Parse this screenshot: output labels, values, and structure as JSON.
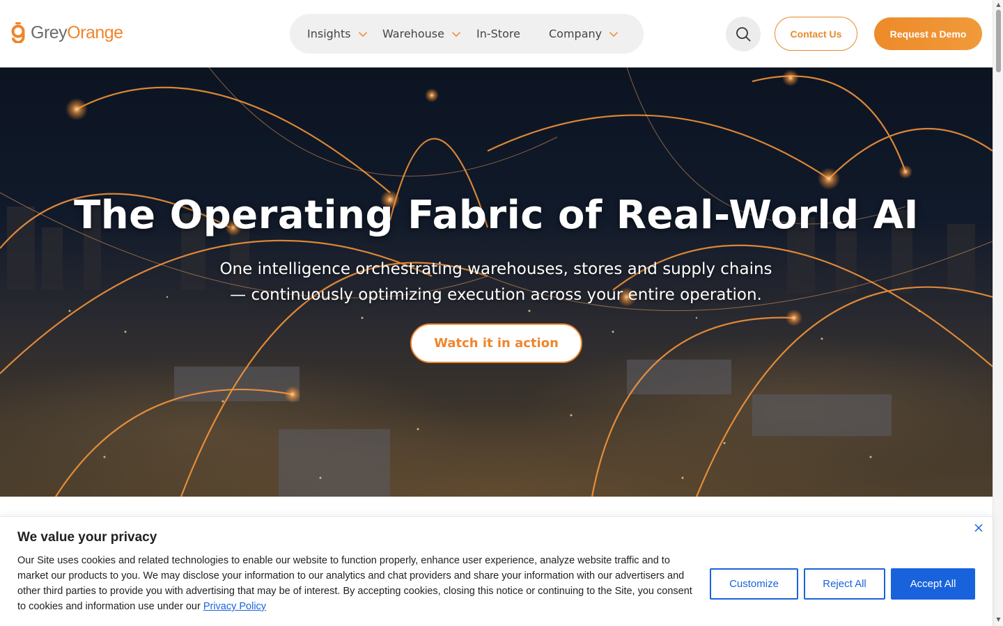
{
  "header": {
    "logo": {
      "grey_text": "Grey",
      "orange_text": "Orange"
    },
    "nav": [
      {
        "label": "Insights",
        "has_dropdown": true
      },
      {
        "label": "Warehouse",
        "has_dropdown": true
      },
      {
        "label": "In-Store",
        "has_dropdown": false
      },
      {
        "label": "Company",
        "has_dropdown": true
      }
    ],
    "search_icon": "search-icon",
    "contact_label": "Contact Us",
    "demo_label": "Request a Demo"
  },
  "hero": {
    "title": "The Operating Fabric of Real-World AI",
    "subtitle_line1": "One intelligence orchestrating warehouses, stores and supply chains",
    "subtitle_line2": "— continuously optimizing execution across your entire operation.",
    "cta_label": "Watch it in action"
  },
  "cookie_banner": {
    "title": "We value your privacy",
    "body": "Our Site uses cookies and related technologies to enable our website to function properly, enhance user experience, analyze website traffic and to market our products to you. We may disclose your information to our analytics and chat providers and share your information with our advertisers and other third parties to provide you with advertising that may be of interest. By accepting cookies, closing this notice or continuing to the Site, you consent to cookies and information use under our",
    "link_label": "Privacy Policy",
    "customize_label": "Customize",
    "reject_label": "Reject All",
    "accept_label": "Accept All"
  },
  "colors": {
    "brand_orange": "#f0852a",
    "brand_grey": "#6b6b6b",
    "cookie_blue": "#1863dc"
  }
}
